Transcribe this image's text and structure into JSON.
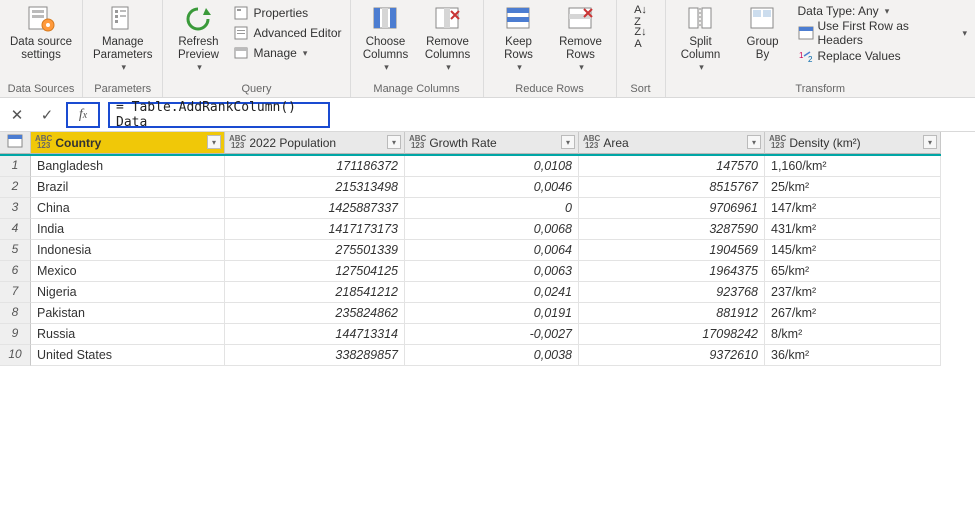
{
  "ribbon": {
    "dataSources": {
      "btn": "Data source\nsettings",
      "title": "Data Sources"
    },
    "parameters": {
      "btn": "Manage\nParameters",
      "title": "Parameters"
    },
    "query": {
      "refresh": "Refresh\nPreview",
      "properties": "Properties",
      "advanced": "Advanced Editor",
      "manage": "Manage",
      "title": "Query"
    },
    "manageColumns": {
      "choose": "Choose\nColumns",
      "remove": "Remove\nColumns",
      "title": "Manage Columns"
    },
    "reduceRows": {
      "keep": "Keep\nRows",
      "remove": "Remove\nRows",
      "title": "Reduce Rows"
    },
    "sort": {
      "title": "Sort"
    },
    "transformMain": {
      "split": "Split\nColumn",
      "group": "Group\nBy",
      "dataType": "Data Type: Any",
      "firstRow": "Use First Row as Headers",
      "replace": "Replace Values",
      "title": "Transform"
    }
  },
  "formula": "= Table.AddRankColumn() Data",
  "columns": [
    "Country",
    "2022 Population",
    "Growth Rate",
    "Area",
    "Density (km²)"
  ],
  "rows": [
    {
      "i": "1",
      "country": "Bangladesh",
      "pop": "171186372",
      "growth": "0,0108",
      "area": "147570",
      "density": "1,160/km²"
    },
    {
      "i": "2",
      "country": "Brazil",
      "pop": "215313498",
      "growth": "0,0046",
      "area": "8515767",
      "density": "25/km²"
    },
    {
      "i": "3",
      "country": "China",
      "pop": "1425887337",
      "growth": "0",
      "area": "9706961",
      "density": "147/km²"
    },
    {
      "i": "4",
      "country": "India",
      "pop": "1417173173",
      "growth": "0,0068",
      "area": "3287590",
      "density": "431/km²"
    },
    {
      "i": "5",
      "country": "Indonesia",
      "pop": "275501339",
      "growth": "0,0064",
      "area": "1904569",
      "density": "145/km²"
    },
    {
      "i": "6",
      "country": "Mexico",
      "pop": "127504125",
      "growth": "0,0063",
      "area": "1964375",
      "density": "65/km²"
    },
    {
      "i": "7",
      "country": "Nigeria",
      "pop": "218541212",
      "growth": "0,0241",
      "area": "923768",
      "density": "237/km²"
    },
    {
      "i": "8",
      "country": "Pakistan",
      "pop": "235824862",
      "growth": "0,0191",
      "area": "881912",
      "density": "267/km²"
    },
    {
      "i": "9",
      "country": "Russia",
      "pop": "144713314",
      "growth": "-0,0027",
      "area": "17098242",
      "density": "8/km²"
    },
    {
      "i": "10",
      "country": "United States",
      "pop": "338289857",
      "growth": "0,0038",
      "area": "9372610",
      "density": "36/km²"
    }
  ]
}
